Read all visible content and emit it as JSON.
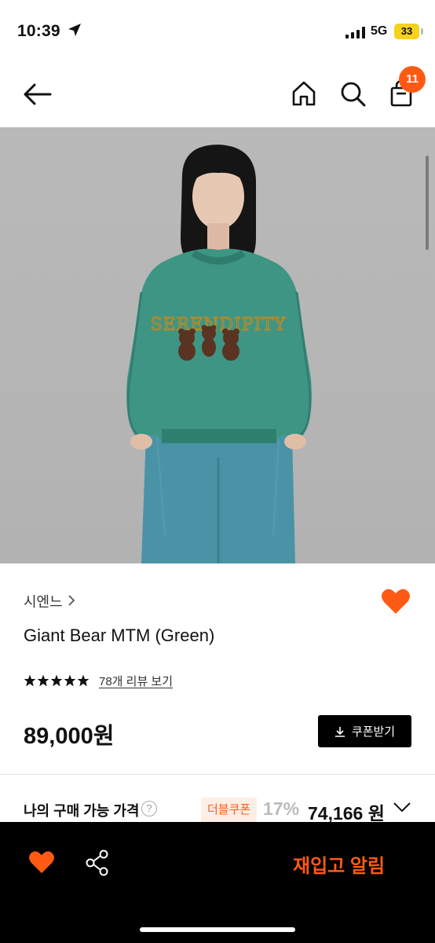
{
  "status_bar": {
    "time": "10:39",
    "network": "5G",
    "battery": "33"
  },
  "nav": {
    "cart_count": "11"
  },
  "product": {
    "brand": "시엔느",
    "name": "Giant Bear MTM (Green)",
    "rating_stars": 5,
    "reviews_link": "78개 리뷰 보기",
    "price": "89,000원",
    "coupon_button": "쿠폰받기",
    "image_text": "SERENDIPITY"
  },
  "my_price": {
    "label": "나의 구매 가능 가격",
    "help": "?",
    "tag": "더블쿠폰",
    "discount": "17%",
    "final_price": "74,166 원"
  },
  "bottom_bar": {
    "restock_label": "재입고 알림"
  },
  "colors": {
    "accent": "#ff5a14",
    "black": "#000000",
    "tag_bg": "#fdeee6"
  }
}
